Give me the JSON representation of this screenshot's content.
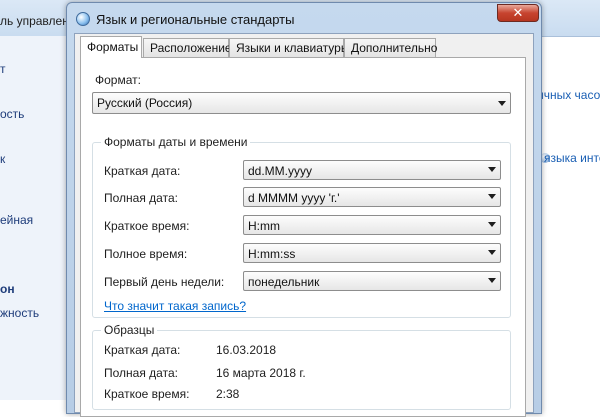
{
  "background": {
    "path_text": "ль управлен",
    "left_links": [
      "т",
      "ость",
      "к",
      "ейная",
      "он",
      "жность"
    ],
    "right_links": [
      "ичных часо",
      "языка инте"
    ]
  },
  "dialog": {
    "title": "Язык и региональные стандарты",
    "close_glyph": "✕",
    "tabs": [
      "Форматы",
      "Расположение",
      "Языки и клавиатуры",
      "Дополнительно"
    ],
    "active_tab": 0
  },
  "formats": {
    "format_label": "Формат:",
    "format_value": "Русский (Россия)",
    "datetime_group_title": "Форматы даты и времени",
    "rows": [
      {
        "label": "Краткая дата:",
        "value": "dd.MM.yyyy"
      },
      {
        "label": "Полная дата:",
        "value": "d MMMM yyyy 'г.'"
      },
      {
        "label": "Краткое время:",
        "value": "H:mm"
      },
      {
        "label": "Полное время:",
        "value": "H:mm:ss"
      },
      {
        "label": "Первый день недели:",
        "value": "понедельник"
      }
    ],
    "help_link": "Что значит такая запись?",
    "samples_group_title": "Образцы",
    "samples": [
      {
        "label": "Краткая дата:",
        "value": "16.03.2018"
      },
      {
        "label": "Полная дата:",
        "value": "16 марта 2018 г."
      },
      {
        "label": "Краткое время:",
        "value": "2:38"
      }
    ]
  },
  "colors": {
    "link": "#0066cc",
    "close_button": "#c7442f",
    "titlebar": "#c5d9ee"
  }
}
